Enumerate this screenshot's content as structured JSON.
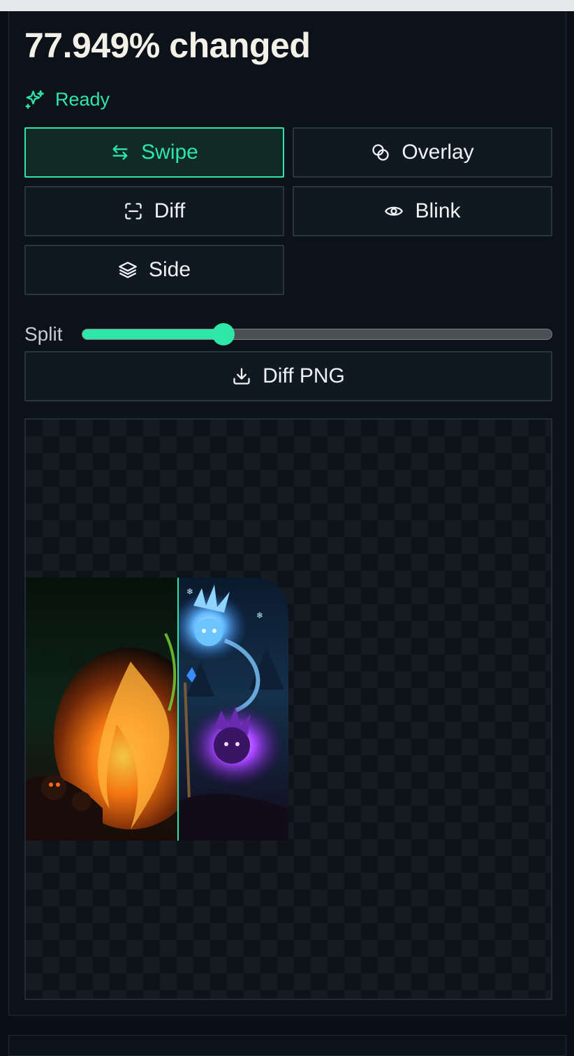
{
  "headline": "77.949% changed",
  "status": {
    "text": "Ready",
    "icon": "sparkles-icon",
    "color": "#2ee6a8"
  },
  "modes": [
    {
      "label": "Swipe",
      "icon": "swap-arrows-icon",
      "active": true
    },
    {
      "label": "Overlay",
      "icon": "overlap-circles-icon",
      "active": false
    },
    {
      "label": "Diff",
      "icon": "scan-frame-icon",
      "active": false
    },
    {
      "label": "Blink",
      "icon": "eye-icon",
      "active": false
    },
    {
      "label": "Side",
      "icon": "layers-icon",
      "active": false
    }
  ],
  "split": {
    "label": "Split",
    "value": 0.3
  },
  "download": {
    "label": "Diff PNG",
    "icon": "download-icon"
  },
  "viewer": {
    "left_image": "fire forest creature",
    "right_image": "ice and arcane spirits"
  },
  "colors": {
    "accent": "#2ee6a8",
    "background": "#0c1219"
  }
}
